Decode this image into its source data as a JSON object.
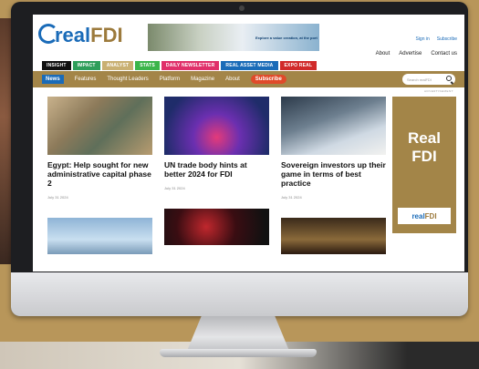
{
  "header": {
    "logo_real": "real",
    "logo_fdi": "FDI",
    "banner_text": "Explore a value creation, at the port"
  },
  "top_links": [
    "Sign in",
    "Subscribe"
  ],
  "util_nav": [
    "About",
    "Advertise",
    "Contact us"
  ],
  "tags": [
    {
      "label": "INSIGHT",
      "color": "#111111"
    },
    {
      "label": "IMPACT",
      "color": "#2e9e5a"
    },
    {
      "label": "ANALYST",
      "color": "#c9b072"
    },
    {
      "label": "STATS",
      "color": "#3bb54a"
    },
    {
      "label": "DAILY NEWSLETTER",
      "color": "#e0306a"
    },
    {
      "label": "REAL ASSET MEDIA",
      "color": "#1a6bb8"
    },
    {
      "label": "EXPO REAL",
      "color": "#d12a2a"
    }
  ],
  "nav": {
    "items": [
      "News",
      "Features",
      "Thought Leaders",
      "Platform",
      "Magazine",
      "About"
    ],
    "subscribe": "Subscribe",
    "search_placeholder": "Search realFDI"
  },
  "ad_label": "ADVERTISEMENT",
  "articles": [
    {
      "title": "Egypt: Help sought for new administrative capital phase 2",
      "date": "July 31 2024"
    },
    {
      "title": "UN trade body hints at better 2024 for FDI",
      "date": "July 31 2024"
    },
    {
      "title": "Sovereign investors up their game in terms of best practice",
      "date": "July 31 2024"
    }
  ],
  "side_ad": {
    "line1": "Real",
    "line2": "FDI",
    "logo_real": "real",
    "logo_fdi": "FDI"
  }
}
